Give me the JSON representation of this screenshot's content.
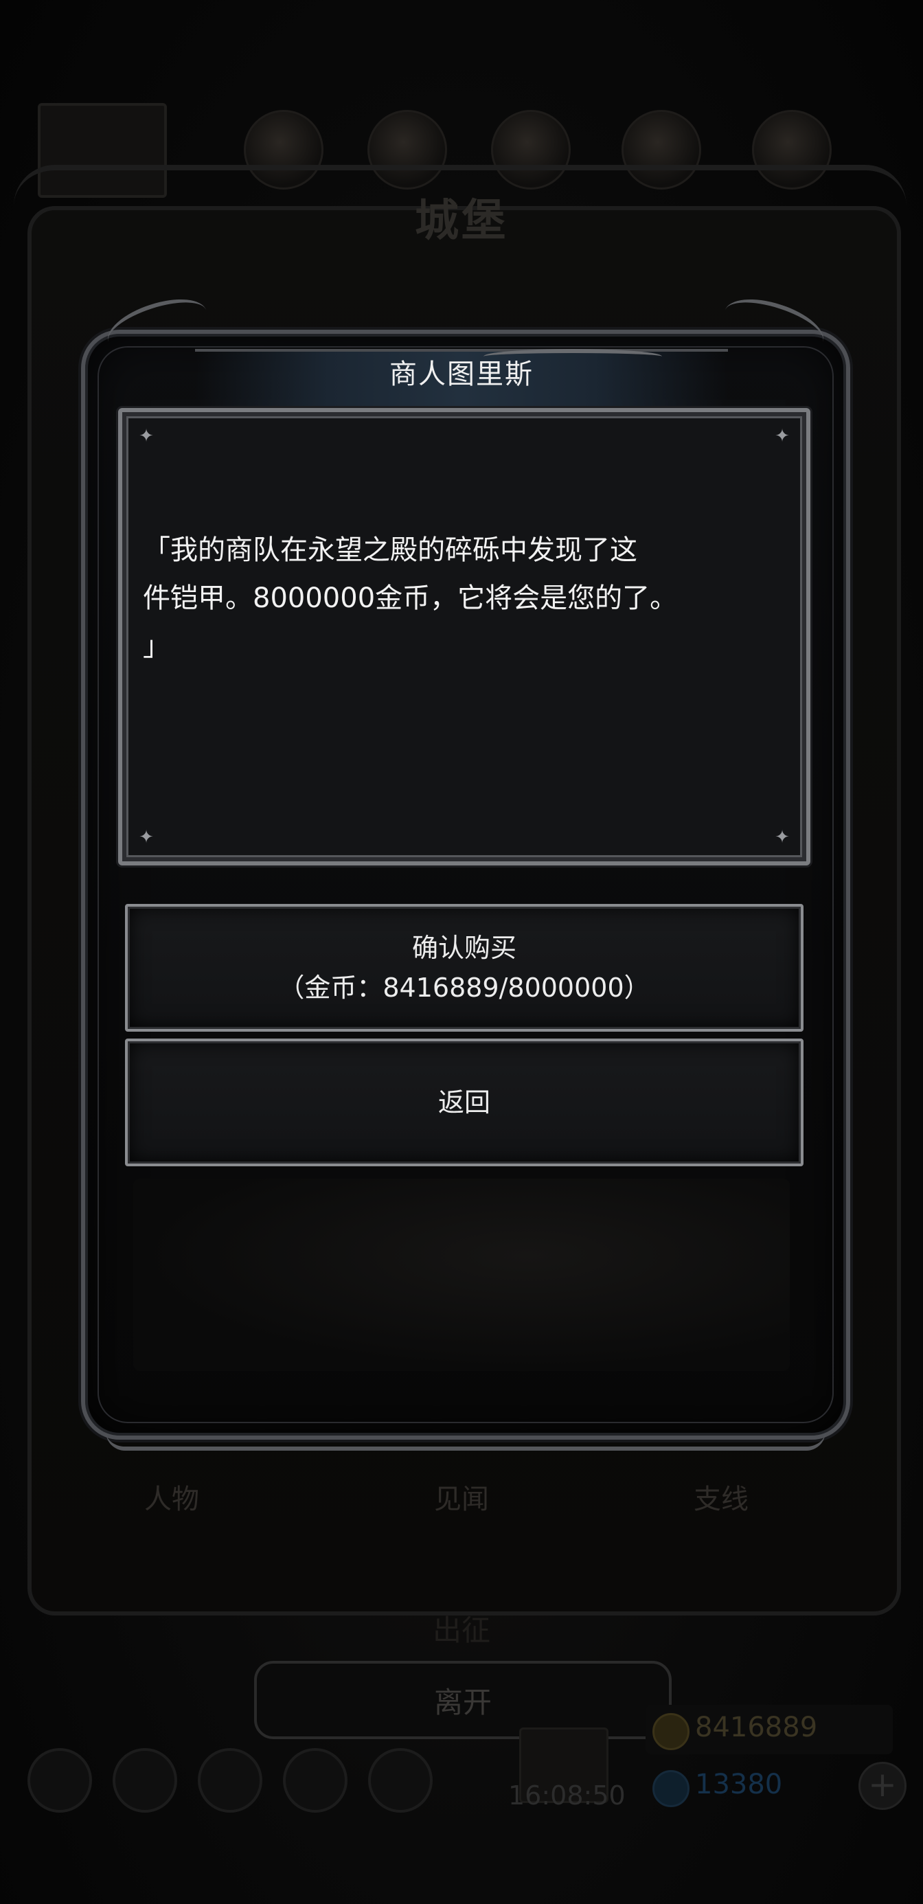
{
  "background": {
    "castle_title": "城堡",
    "tabs": [
      "人物",
      "见闻",
      "支线"
    ],
    "march_label": "出征",
    "leave_button": "离开",
    "clock": "16:08:50",
    "gold_amount": "8416889",
    "gem_amount": "13380",
    "top_icons": [
      "portrait-icon",
      "potion-icon",
      "chest-icon",
      "scroll-icon",
      "feather-icon",
      "crossed-swords-icon"
    ],
    "dock_icons": [
      "settings-icon",
      "face-icon",
      "bag-icon",
      "book-icon",
      "box-icon"
    ]
  },
  "dialog": {
    "title": "商人图里斯",
    "text": "「我的商队在永望之殿的碎砾中发现了这\n件铠甲。8000000金币，它将会是您的了。\n」",
    "confirm_label": "确认购买",
    "confirm_sub": "（金币：8416889/8000000）",
    "back_label": "返回"
  },
  "colors": {
    "panel_border": "#7a7c80",
    "panel_bg": "#131416",
    "text": "#f2f2f2",
    "title_banner": "#22303e"
  }
}
